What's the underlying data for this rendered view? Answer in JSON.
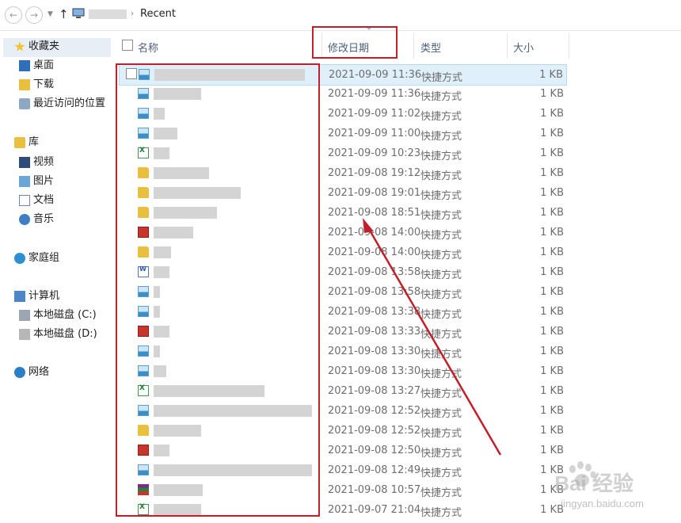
{
  "address": {
    "crumb": "Recent"
  },
  "sidebar": {
    "items": [
      {
        "label": "收藏夹",
        "icon": "star-icon"
      },
      {
        "label": "桌面",
        "icon": "desktop-icon"
      },
      {
        "label": "下载",
        "icon": "download-icon"
      },
      {
        "label": "最近访问的位置",
        "icon": "recent-places-icon"
      },
      {
        "label": "库",
        "icon": "library-icon"
      },
      {
        "label": "视频",
        "icon": "video-icon"
      },
      {
        "label": "图片",
        "icon": "pictures-icon"
      },
      {
        "label": "文档",
        "icon": "documents-icon"
      },
      {
        "label": "音乐",
        "icon": "music-icon"
      },
      {
        "label": "家庭组",
        "icon": "homegroup-icon"
      },
      {
        "label": "计算机",
        "icon": "computer-icon"
      },
      {
        "label": "本地磁盘 (C:)",
        "icon": "drive-c-icon"
      },
      {
        "label": "本地磁盘 (D:)",
        "icon": "drive-d-icon"
      },
      {
        "label": "网络",
        "icon": "network-icon"
      }
    ]
  },
  "columns": {
    "name": "名称",
    "date": "修改日期",
    "type": "类型",
    "size": "大小"
  },
  "files": [
    {
      "icon": "picture-icon",
      "date": "2021-09-09 11:36",
      "type": "快捷方式",
      "size": "1 KB"
    },
    {
      "icon": "picture-icon",
      "date": "2021-09-09 11:36",
      "type": "快捷方式",
      "size": "1 KB"
    },
    {
      "icon": "picture-icon",
      "date": "2021-09-09 11:02",
      "type": "快捷方式",
      "size": "1 KB"
    },
    {
      "icon": "picture-icon",
      "date": "2021-09-09 11:00",
      "type": "快捷方式",
      "size": "1 KB"
    },
    {
      "icon": "excel-icon",
      "date": "2021-09-09 10:23",
      "type": "快捷方式",
      "size": "1 KB"
    },
    {
      "icon": "folder-icon",
      "date": "2021-09-08 19:12",
      "type": "快捷方式",
      "size": "1 KB"
    },
    {
      "icon": "folder-icon",
      "date": "2021-09-08 19:01",
      "type": "快捷方式",
      "size": "1 KB"
    },
    {
      "icon": "folder-icon",
      "date": "2021-09-08 18:51",
      "type": "快捷方式",
      "size": "1 KB"
    },
    {
      "icon": "red-file-icon",
      "date": "2021-09-08 14:00",
      "type": "快捷方式",
      "size": "1 KB"
    },
    {
      "icon": "folder-icon",
      "date": "2021-09-08 14:00",
      "type": "快捷方式",
      "size": "1 KB"
    },
    {
      "icon": "word-icon",
      "date": "2021-09-08 13:58",
      "type": "快捷方式",
      "size": "1 KB"
    },
    {
      "icon": "picture-icon",
      "date": "2021-09-08 13:58",
      "type": "快捷方式",
      "size": "1 KB"
    },
    {
      "icon": "picture-icon",
      "date": "2021-09-08 13:38",
      "type": "快捷方式",
      "size": "1 KB"
    },
    {
      "icon": "red-file-icon",
      "date": "2021-09-08 13:33",
      "type": "快捷方式",
      "size": "1 KB"
    },
    {
      "icon": "picture-icon",
      "date": "2021-09-08 13:30",
      "type": "快捷方式",
      "size": "1 KB"
    },
    {
      "icon": "picture-icon",
      "date": "2021-09-08 13:30",
      "type": "快捷方式",
      "size": "1 KB"
    },
    {
      "icon": "excel-icon",
      "date": "2021-09-08 13:27",
      "type": "快捷方式",
      "size": "1 KB"
    },
    {
      "icon": "picture-icon",
      "date": "2021-09-08 12:52",
      "type": "快捷方式",
      "size": "1 KB"
    },
    {
      "icon": "folder-icon",
      "date": "2021-09-08 12:52",
      "type": "快捷方式",
      "size": "1 KB"
    },
    {
      "icon": "red-file-icon",
      "date": "2021-09-08 12:50",
      "type": "快捷方式",
      "size": "1 KB"
    },
    {
      "icon": "picture-icon",
      "date": "2021-09-08 12:49",
      "type": "快捷方式",
      "size": "1 KB"
    },
    {
      "icon": "rar-icon",
      "date": "2021-09-08 10:57",
      "type": "快捷方式",
      "size": "1 KB"
    },
    {
      "icon": "excel-icon",
      "date": "2021-09-07 21:04",
      "type": "快捷方式",
      "size": "1 KB"
    }
  ],
  "watermark": {
    "logo": "Bai 经验",
    "url": "jingyan.baidu.com"
  }
}
